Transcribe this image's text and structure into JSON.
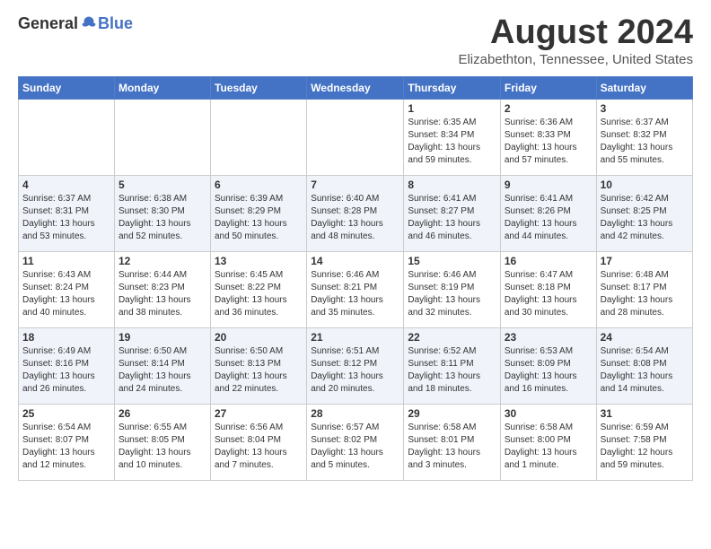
{
  "header": {
    "logo_general": "General",
    "logo_blue": "Blue",
    "month_title": "August 2024",
    "location": "Elizabethton, Tennessee, United States"
  },
  "days_of_week": [
    "Sunday",
    "Monday",
    "Tuesday",
    "Wednesday",
    "Thursday",
    "Friday",
    "Saturday"
  ],
  "weeks": [
    [
      {
        "day": "",
        "info": ""
      },
      {
        "day": "",
        "info": ""
      },
      {
        "day": "",
        "info": ""
      },
      {
        "day": "",
        "info": ""
      },
      {
        "day": "1",
        "info": "Sunrise: 6:35 AM\nSunset: 8:34 PM\nDaylight: 13 hours\nand 59 minutes."
      },
      {
        "day": "2",
        "info": "Sunrise: 6:36 AM\nSunset: 8:33 PM\nDaylight: 13 hours\nand 57 minutes."
      },
      {
        "day": "3",
        "info": "Sunrise: 6:37 AM\nSunset: 8:32 PM\nDaylight: 13 hours\nand 55 minutes."
      }
    ],
    [
      {
        "day": "4",
        "info": "Sunrise: 6:37 AM\nSunset: 8:31 PM\nDaylight: 13 hours\nand 53 minutes."
      },
      {
        "day": "5",
        "info": "Sunrise: 6:38 AM\nSunset: 8:30 PM\nDaylight: 13 hours\nand 52 minutes."
      },
      {
        "day": "6",
        "info": "Sunrise: 6:39 AM\nSunset: 8:29 PM\nDaylight: 13 hours\nand 50 minutes."
      },
      {
        "day": "7",
        "info": "Sunrise: 6:40 AM\nSunset: 8:28 PM\nDaylight: 13 hours\nand 48 minutes."
      },
      {
        "day": "8",
        "info": "Sunrise: 6:41 AM\nSunset: 8:27 PM\nDaylight: 13 hours\nand 46 minutes."
      },
      {
        "day": "9",
        "info": "Sunrise: 6:41 AM\nSunset: 8:26 PM\nDaylight: 13 hours\nand 44 minutes."
      },
      {
        "day": "10",
        "info": "Sunrise: 6:42 AM\nSunset: 8:25 PM\nDaylight: 13 hours\nand 42 minutes."
      }
    ],
    [
      {
        "day": "11",
        "info": "Sunrise: 6:43 AM\nSunset: 8:24 PM\nDaylight: 13 hours\nand 40 minutes."
      },
      {
        "day": "12",
        "info": "Sunrise: 6:44 AM\nSunset: 8:23 PM\nDaylight: 13 hours\nand 38 minutes."
      },
      {
        "day": "13",
        "info": "Sunrise: 6:45 AM\nSunset: 8:22 PM\nDaylight: 13 hours\nand 36 minutes."
      },
      {
        "day": "14",
        "info": "Sunrise: 6:46 AM\nSunset: 8:21 PM\nDaylight: 13 hours\nand 35 minutes."
      },
      {
        "day": "15",
        "info": "Sunrise: 6:46 AM\nSunset: 8:19 PM\nDaylight: 13 hours\nand 32 minutes."
      },
      {
        "day": "16",
        "info": "Sunrise: 6:47 AM\nSunset: 8:18 PM\nDaylight: 13 hours\nand 30 minutes."
      },
      {
        "day": "17",
        "info": "Sunrise: 6:48 AM\nSunset: 8:17 PM\nDaylight: 13 hours\nand 28 minutes."
      }
    ],
    [
      {
        "day": "18",
        "info": "Sunrise: 6:49 AM\nSunset: 8:16 PM\nDaylight: 13 hours\nand 26 minutes."
      },
      {
        "day": "19",
        "info": "Sunrise: 6:50 AM\nSunset: 8:14 PM\nDaylight: 13 hours\nand 24 minutes."
      },
      {
        "day": "20",
        "info": "Sunrise: 6:50 AM\nSunset: 8:13 PM\nDaylight: 13 hours\nand 22 minutes."
      },
      {
        "day": "21",
        "info": "Sunrise: 6:51 AM\nSunset: 8:12 PM\nDaylight: 13 hours\nand 20 minutes."
      },
      {
        "day": "22",
        "info": "Sunrise: 6:52 AM\nSunset: 8:11 PM\nDaylight: 13 hours\nand 18 minutes."
      },
      {
        "day": "23",
        "info": "Sunrise: 6:53 AM\nSunset: 8:09 PM\nDaylight: 13 hours\nand 16 minutes."
      },
      {
        "day": "24",
        "info": "Sunrise: 6:54 AM\nSunset: 8:08 PM\nDaylight: 13 hours\nand 14 minutes."
      }
    ],
    [
      {
        "day": "25",
        "info": "Sunrise: 6:54 AM\nSunset: 8:07 PM\nDaylight: 13 hours\nand 12 minutes."
      },
      {
        "day": "26",
        "info": "Sunrise: 6:55 AM\nSunset: 8:05 PM\nDaylight: 13 hours\nand 10 minutes."
      },
      {
        "day": "27",
        "info": "Sunrise: 6:56 AM\nSunset: 8:04 PM\nDaylight: 13 hours\nand 7 minutes."
      },
      {
        "day": "28",
        "info": "Sunrise: 6:57 AM\nSunset: 8:02 PM\nDaylight: 13 hours\nand 5 minutes."
      },
      {
        "day": "29",
        "info": "Sunrise: 6:58 AM\nSunset: 8:01 PM\nDaylight: 13 hours\nand 3 minutes."
      },
      {
        "day": "30",
        "info": "Sunrise: 6:58 AM\nSunset: 8:00 PM\nDaylight: 13 hours\nand 1 minute."
      },
      {
        "day": "31",
        "info": "Sunrise: 6:59 AM\nSunset: 7:58 PM\nDaylight: 12 hours\nand 59 minutes."
      }
    ]
  ]
}
